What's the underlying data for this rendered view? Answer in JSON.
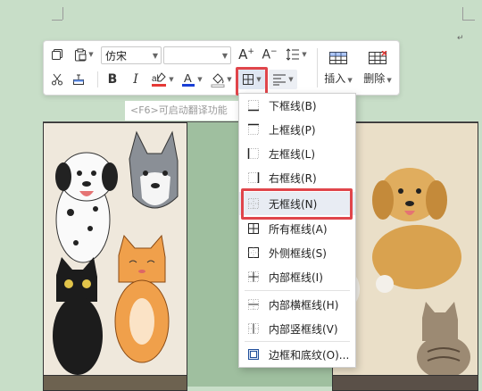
{
  "toolbar": {
    "font_name": "仿宋",
    "font_size": "",
    "insert_label": "插入",
    "delete_label": "删除"
  },
  "hint_text": "<F6>可启动翻译功能",
  "border_menu": {
    "items": [
      {
        "label": "下框线(B)",
        "icon": "bottom-border-icon"
      },
      {
        "label": "上框线(P)",
        "icon": "top-border-icon"
      },
      {
        "label": "左框线(L)",
        "icon": "left-border-icon"
      },
      {
        "label": "右框线(R)",
        "icon": "right-border-icon"
      },
      {
        "label": "无框线(N)",
        "icon": "no-border-icon"
      },
      {
        "label": "所有框线(A)",
        "icon": "all-borders-icon"
      },
      {
        "label": "外侧框线(S)",
        "icon": "outside-borders-icon"
      },
      {
        "label": "内部框线(I)",
        "icon": "inside-borders-icon"
      },
      {
        "label": "内部横框线(H)",
        "icon": "inside-horizontal-border-icon"
      },
      {
        "label": "内部竖框线(V)",
        "icon": "inside-vertical-border-icon"
      },
      {
        "label": "边框和底纹(O)...",
        "icon": "borders-and-shading-icon"
      }
    ]
  },
  "colors": {
    "page_background": "#c8dec8",
    "highlight": "#e0454b",
    "font_color_underline": "#1a3fd6",
    "highlight_underline": "#e53935"
  }
}
